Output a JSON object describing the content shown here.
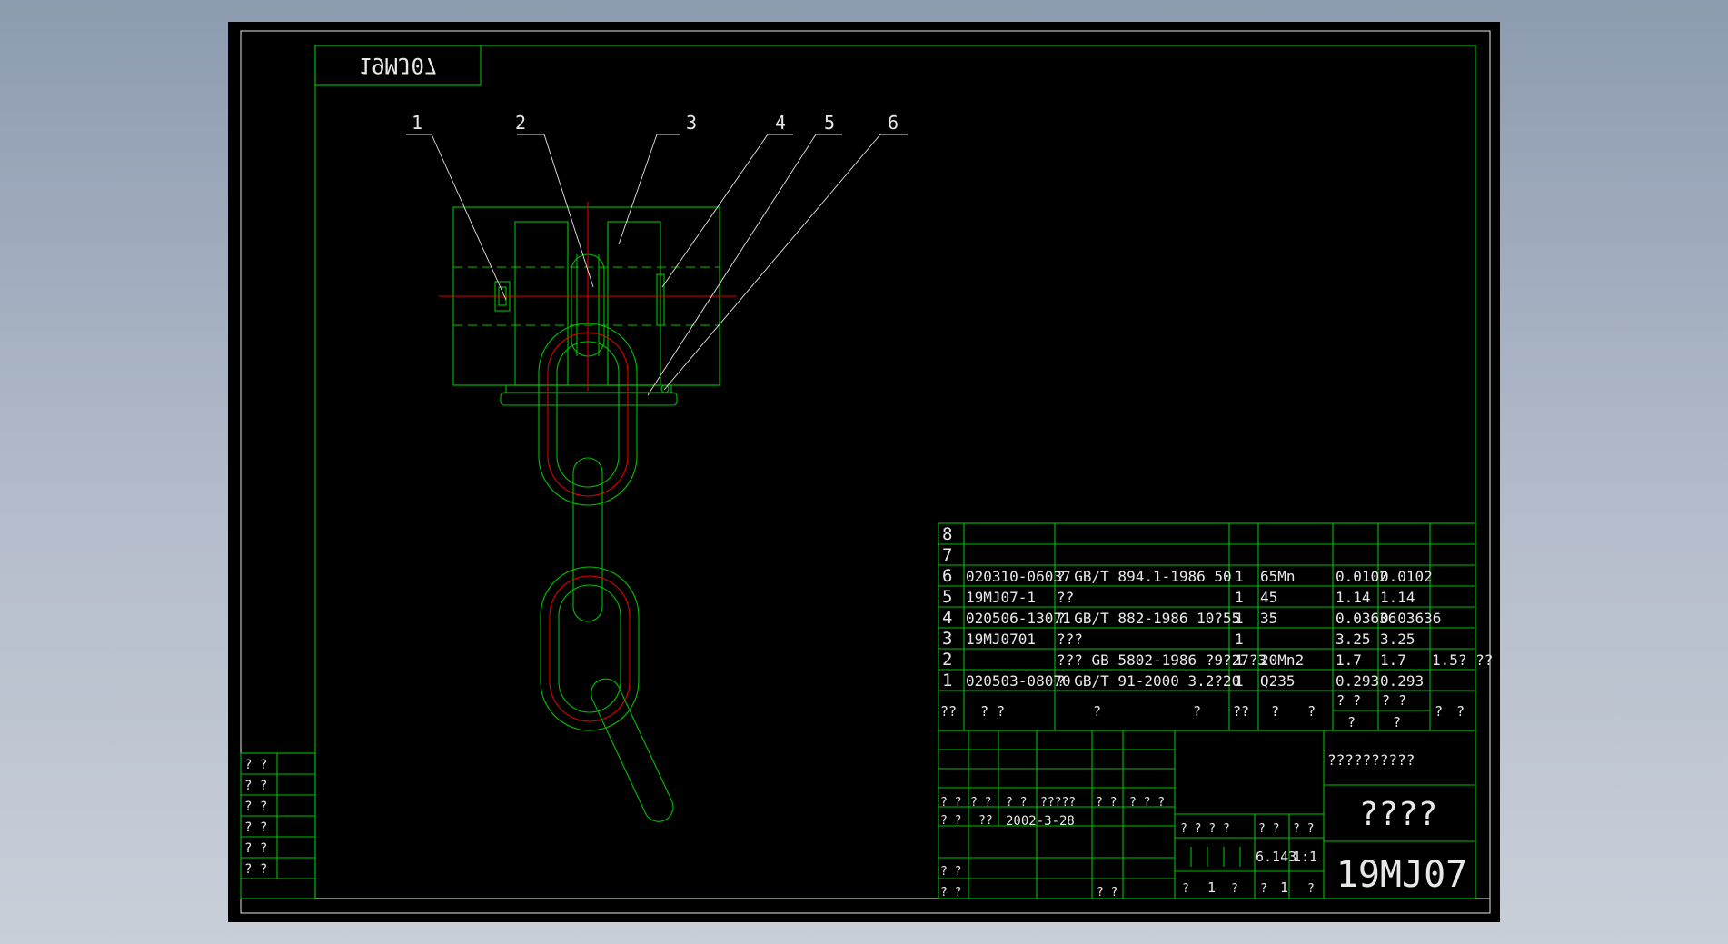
{
  "drawing": {
    "mirrored_code": "19MJ07",
    "balloons": [
      "1",
      "2",
      "3",
      "4",
      "5",
      "6"
    ],
    "left_strip": [
      "? ?",
      "? ?",
      "? ?",
      "? ?",
      "? ?",
      "? ?"
    ]
  },
  "bom": {
    "rows": [
      {
        "no": "8",
        "code": "",
        "name": "",
        "qty": "",
        "mat": "",
        "unit": "",
        "total": "",
        "note": ""
      },
      {
        "no": "7",
        "code": "",
        "name": "",
        "qty": "",
        "mat": "",
        "unit": "",
        "total": "",
        "note": ""
      },
      {
        "no": "6",
        "code": "020310-06037",
        "name": "? GB/T 894.1-1986 50",
        "qty": "1",
        "mat": "65Mn",
        "unit": "0.0102",
        "total": "0.0102",
        "note": ""
      },
      {
        "no": "5",
        "code": "19MJ07-1",
        "name": "??",
        "qty": "1",
        "mat": "45",
        "unit": "1.14",
        "total": "1.14",
        "note": ""
      },
      {
        "no": "4",
        "code": "020506-13071",
        "name": "? GB/T 882-1986 10?55",
        "qty": "1",
        "mat": "35",
        "unit": "0.03636",
        "total": "0.03636",
        "note": ""
      },
      {
        "no": "3",
        "code": "19MJ0701",
        "name": "???",
        "qty": "1",
        "mat": "",
        "unit": "3.25",
        "total": "3.25",
        "note": ""
      },
      {
        "no": "2",
        "code": "",
        "name": "??? GB 5802-1986 ?9?27?3",
        "qty": "1",
        "mat": "20Mn2",
        "unit": "1.7",
        "total": "1.7",
        "note": "1.5? ??"
      },
      {
        "no": "1",
        "code": "020503-08070",
        "name": "? GB/T 91-2000 3.2?20",
        "qty": "1",
        "mat": "Q235",
        "unit": "0.293",
        "total": "0.293",
        "note": ""
      }
    ],
    "header": {
      "no": "??",
      "code": "?  ?",
      "name1": "?",
      "name2": "?",
      "qty": "??",
      "mat1": "?",
      "mat2": "?",
      "weight_top1": "? ?",
      "weight_top2": "? ?",
      "weight_bot1": "?",
      "weight_bot2": "?",
      "note1": "?",
      "note2": "?"
    }
  },
  "title_block": {
    "company": "??????????",
    "drawing_name": "????",
    "drawing_code": "19MJ07",
    "date": "2002-3-28",
    "signer": "??",
    "stage_label": "? ? ? ?",
    "weight_label": "? ?",
    "scale_label": "? ?",
    "weight_value": "6.143",
    "scale_value": "1:1",
    "sheet_of": [
      "?",
      "1",
      "?",
      "?",
      "1",
      "?"
    ],
    "rev_labels": [
      "? ?",
      "? ?",
      "? ?",
      "?????",
      "? ?",
      "? ? ?"
    ],
    "rows_left": [
      "? ?",
      "??",
      "? ?",
      "? ?",
      "? ?"
    ]
  }
}
